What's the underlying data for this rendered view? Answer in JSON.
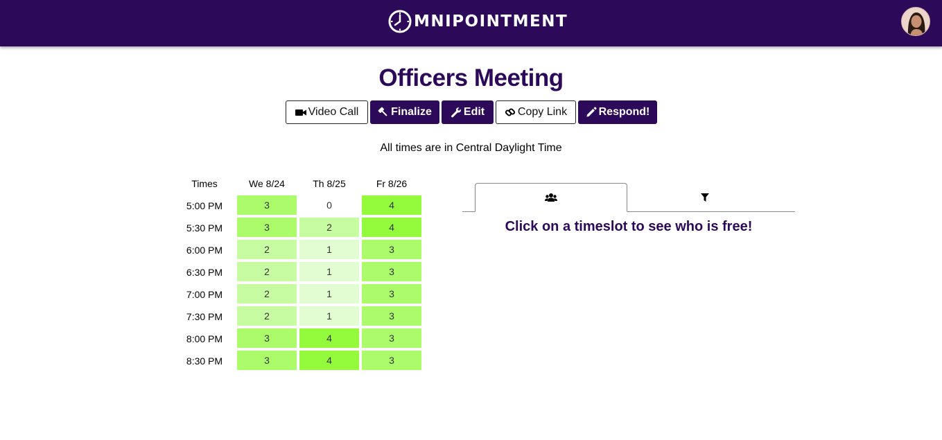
{
  "app": {
    "brand": "MNIPOINTMENT",
    "logo_icon": "clock-icon",
    "accent": "#2d0a59"
  },
  "event": {
    "title": "Officers Meeting"
  },
  "toolbar": {
    "video_call": "Video Call",
    "finalize": "Finalize",
    "edit": "Edit",
    "copy_link": "Copy Link",
    "respond": "Respond!"
  },
  "timezone_note": "All times are in Central Daylight Time",
  "grid": {
    "times_header": "Times",
    "days": [
      "We 8/24",
      "Th 8/25",
      "Fr 8/26"
    ],
    "times": [
      "5:00 PM",
      "5:30 PM",
      "6:00 PM",
      "6:30 PM",
      "7:00 PM",
      "7:30 PM",
      "8:00 PM",
      "8:30 PM"
    ],
    "counts": [
      [
        "3",
        "0",
        "4"
      ],
      [
        "3",
        "2",
        "4"
      ],
      [
        "2",
        "1",
        "3"
      ],
      [
        "2",
        "1",
        "3"
      ],
      [
        "2",
        "1",
        "3"
      ],
      [
        "2",
        "1",
        "3"
      ],
      [
        "3",
        "4",
        "3"
      ],
      [
        "3",
        "4",
        "3"
      ]
    ],
    "max_count": 4,
    "level_colors": {
      "0": "#ffffff",
      "1": "#e3fdd3",
      "2": "#c8fca2",
      "3": "#acfb6b",
      "4": "#93fa3c"
    }
  },
  "side_panel": {
    "tabs": [
      {
        "icon": "users-icon",
        "active": true
      },
      {
        "icon": "filter-icon",
        "active": false
      }
    ],
    "hint": "Click on a timeslot to see who is free!"
  }
}
